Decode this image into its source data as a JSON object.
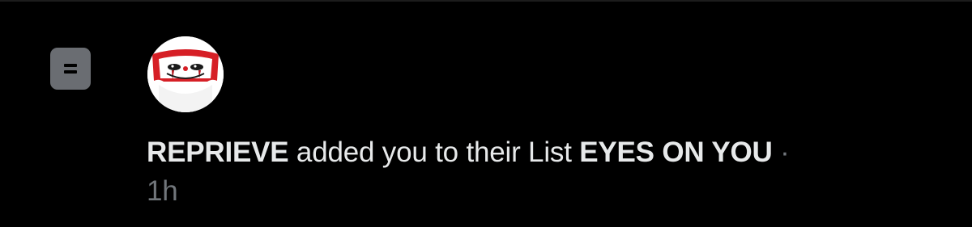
{
  "notification": {
    "icon": "list-icon",
    "avatar_icon": "clown-mask-avatar-icon",
    "actor": "REPRIEVE",
    "action_text": " added you to their List ",
    "list_name": "EYES ON YOU",
    "separator": " ·",
    "time": "1h"
  },
  "colors": {
    "background": "#000000",
    "text_primary": "#e7e9ea",
    "text_secondary": "#71767b",
    "list_icon_bg": "#6a6d72",
    "avatar_red": "#d61f26"
  }
}
